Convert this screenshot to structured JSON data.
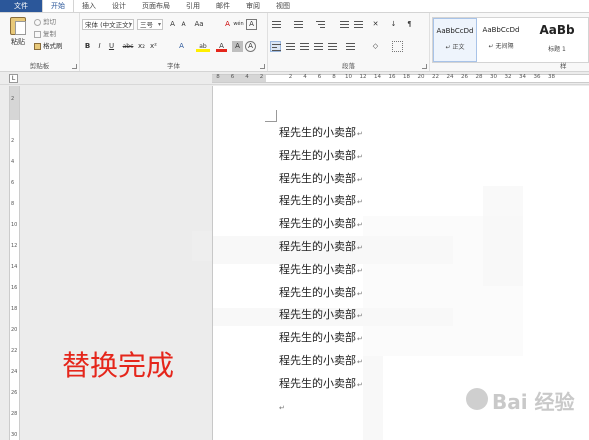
{
  "tabs": [
    "文件",
    "开始",
    "插入",
    "设计",
    "页面布局",
    "引用",
    "邮件",
    "审阅",
    "视图"
  ],
  "active_tab": "开始",
  "clipboard": {
    "paste_label": "粘贴",
    "cut_label": "剪切",
    "copy_label": "复制",
    "format_painter_label": "格式刷",
    "group_label": "剪贴板"
  },
  "font": {
    "font_name": "宋体 (中文正文)",
    "font_size": "三号",
    "group_label": "字体",
    "btn_grow": "A",
    "btn_shrink": "A",
    "btn_case": "Aa",
    "btn_bold": "B",
    "btn_italic": "I",
    "btn_underline": "U",
    "btn_strike": "abc",
    "btn_sub": "x₂",
    "btn_sup": "x²",
    "btn_effects": "A",
    "btn_highlight": "ab",
    "btn_font_color": "A",
    "btn_char_shade": "A",
    "btn_enclose": "A",
    "btn_phonetic": "wén",
    "btn_char_border": "A"
  },
  "paragraph": {
    "group_label": "段落"
  },
  "styles": {
    "items": [
      {
        "preview": "AaBbCcDd",
        "name": "↵ 正文"
      },
      {
        "preview": "AaBbCcDd",
        "name": "↵ 无间隔"
      },
      {
        "preview": "AaBb",
        "name": "标题 1"
      }
    ],
    "group_label": "样"
  },
  "ruler": {
    "corner": "L",
    "numbers": [
      "8",
      "6",
      "4",
      "2",
      "",
      "2",
      "4",
      "6",
      "8",
      "10",
      "12",
      "14",
      "16",
      "18",
      "20",
      "22",
      "24",
      "26",
      "28",
      "30",
      "32",
      "34",
      "36",
      "38"
    ],
    "vnumbers": [
      "2",
      "",
      "2",
      "4",
      "6",
      "8",
      "10",
      "12",
      "14",
      "16",
      "18",
      "20",
      "22",
      "24",
      "26",
      "28",
      "30"
    ]
  },
  "document": {
    "lines": [
      "程先生的小卖部",
      "程先生的小卖部",
      "程先生的小卖部",
      "程先生的小卖部",
      "程先生的小卖部",
      "程先生的小卖部",
      "程先生的小卖部",
      "程先生的小卖部",
      "程先生的小卖部",
      "程先生的小卖部",
      "程先生的小卖部",
      "程先生的小卖部"
    ],
    "paragraph_mark": "↵"
  },
  "caption": "替换完成",
  "watermark": "Bai 经验"
}
